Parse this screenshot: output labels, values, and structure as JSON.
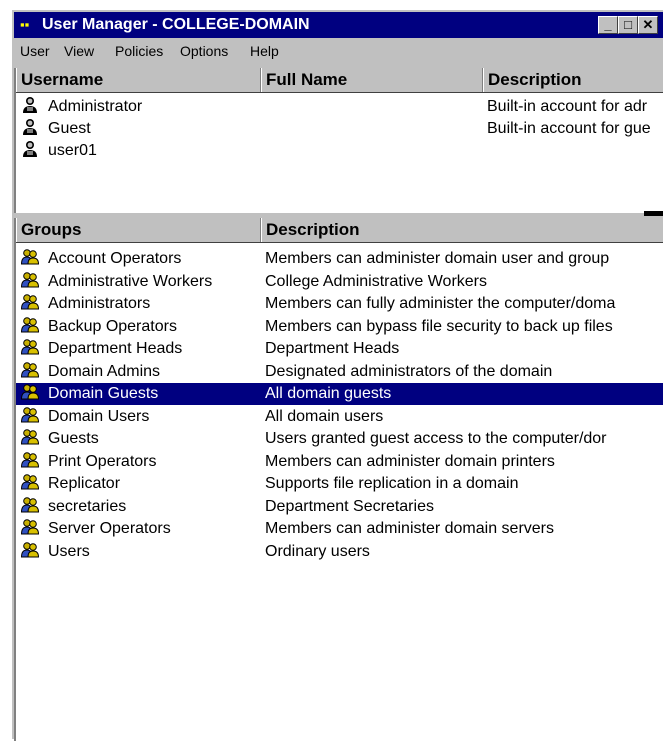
{
  "window": {
    "title": "User Manager - COLLEGE-DOMAIN"
  },
  "menu": [
    "User",
    "View",
    "Policies",
    "Options",
    "Help"
  ],
  "users_pane": {
    "columns": [
      "Username",
      "Full Name",
      "Description"
    ],
    "rows": [
      {
        "username": "Administrator",
        "full_name": "",
        "description": "Built-in account for adr"
      },
      {
        "username": "Guest",
        "full_name": "",
        "description": "Built-in account for gue"
      },
      {
        "username": "user01",
        "full_name": "",
        "description": ""
      }
    ]
  },
  "groups_pane": {
    "columns": [
      "Groups",
      "Description"
    ],
    "selected_index": 6,
    "rows": [
      {
        "name": "Account Operators",
        "description": "Members can administer domain user and group"
      },
      {
        "name": "Administrative Workers",
        "description": "College Administrative Workers"
      },
      {
        "name": "Administrators",
        "description": "Members can fully administer the computer/doma"
      },
      {
        "name": "Backup Operators",
        "description": "Members can bypass file security to back up files"
      },
      {
        "name": "Department Heads",
        "description": "Department Heads"
      },
      {
        "name": "Domain Admins",
        "description": "Designated administrators of the domain"
      },
      {
        "name": "Domain Guests",
        "description": "All domain guests"
      },
      {
        "name": "Domain Users",
        "description": "All domain users"
      },
      {
        "name": "Guests",
        "description": "Users granted guest access to the computer/dor"
      },
      {
        "name": "Print Operators",
        "description": "Members can administer domain printers"
      },
      {
        "name": "Replicator",
        "description": "Supports file replication in a domain"
      },
      {
        "name": "secretaries",
        "description": "Department Secretaries"
      },
      {
        "name": "Server Operators",
        "description": "Members can administer domain servers"
      },
      {
        "name": "Users",
        "description": "Ordinary users"
      }
    ]
  }
}
